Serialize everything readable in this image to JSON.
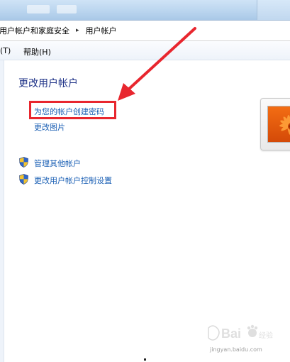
{
  "address_bar": {
    "crumbs": [
      "用户帐户和家庭安全",
      "用户帐户"
    ],
    "separator": "▸"
  },
  "menu": {
    "items": [
      "(T)",
      "帮助(H)"
    ]
  },
  "main": {
    "title": "更改用户帐户",
    "links": {
      "create_password": "为您的帐户创建密码",
      "change_picture": "更改图片",
      "manage_accounts": "管理其他帐户",
      "uac_settings": "更改用户帐户控制设置"
    }
  },
  "icons": {
    "shield": "uac-shield-icon",
    "arrow": "red-arrow-annotation",
    "account_picture": "flower-account-picture"
  },
  "colors": {
    "link": "#1a5fb4",
    "title": "#1e3287",
    "highlight": "#e8262e"
  },
  "watermark": {
    "url": "jingyan.baidu.com"
  }
}
